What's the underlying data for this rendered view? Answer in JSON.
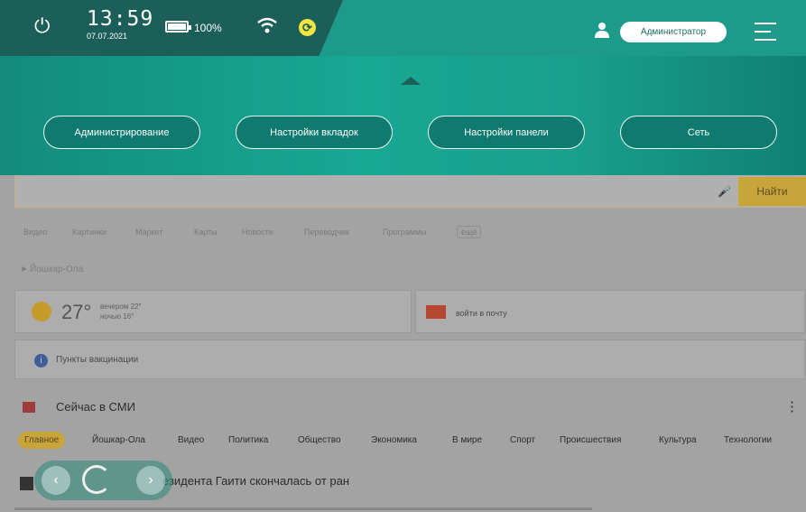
{
  "status": {
    "time": "13:59",
    "date": "07.07.2021",
    "battery_label": "100%",
    "battery_level": 1.0,
    "user_role": "Администратор"
  },
  "panel_buttons": [
    "Администрирование",
    "Настройки вкладок",
    "Настройки панели",
    "Сеть"
  ],
  "browser": {
    "search_button": "Найти",
    "services": [
      "Видео",
      "Картинки",
      "Маркет",
      "Карты",
      "Новости",
      "Переводчик",
      "Программы",
      "ещё"
    ],
    "location": "Йошкар-Ола",
    "weather": {
      "temp": "27°",
      "evening": "вечером 22°",
      "night": "ночью 16°"
    },
    "mail_label": "войти в почту",
    "vaccination_label": "Пункты вакцинации",
    "news_title": "Сейчас в СМИ",
    "news_tabs": [
      "Главное",
      "Йошкар-Ола",
      "Видео",
      "Политика",
      "Общество",
      "Экономика",
      "В мире",
      "Спорт",
      "Происшествия",
      "Культура",
      "Технологии"
    ],
    "headline": "езидента Гаити скончалась от ран"
  }
}
